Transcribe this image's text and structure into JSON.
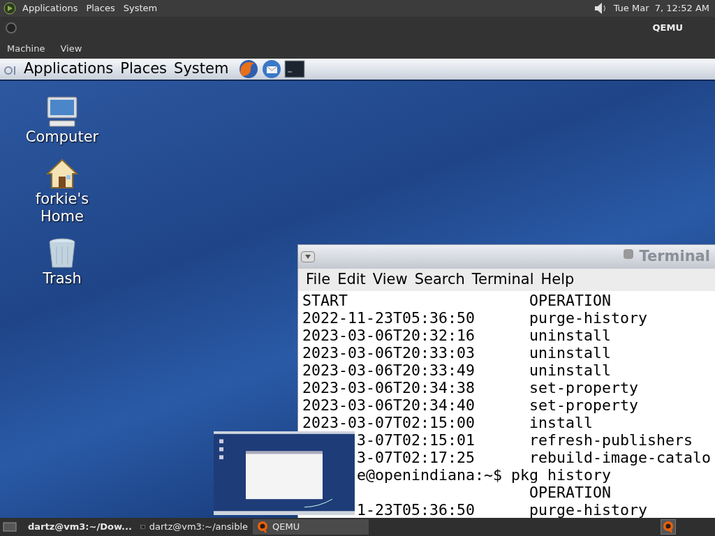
{
  "host_panel": {
    "menus": [
      "Applications",
      "Places",
      "System"
    ],
    "clock": "Tue Mar  7, 12:52 AM"
  },
  "qemu_window": {
    "title": "QEMU",
    "menus": [
      "Machine",
      "View"
    ]
  },
  "guest_panel": {
    "menus": [
      "Applications",
      "Places",
      "System"
    ]
  },
  "desktop_icons": [
    {
      "kind": "computer",
      "label": "Computer"
    },
    {
      "kind": "home",
      "label": "forkie's Home"
    },
    {
      "kind": "trash",
      "label": "Trash"
    }
  ],
  "terminal": {
    "title": "Terminal",
    "menus": [
      "File",
      "Edit",
      "View",
      "Search",
      "Terminal",
      "Help"
    ],
    "lines": [
      {
        "kind": "row",
        "start": "START",
        "operation": "OPERATION"
      },
      {
        "kind": "row",
        "start": "2022-11-23T05:36:50",
        "operation": "purge-history"
      },
      {
        "kind": "row",
        "start": "2023-03-06T20:32:16",
        "operation": "uninstall"
      },
      {
        "kind": "row",
        "start": "2023-03-06T20:33:03",
        "operation": "uninstall"
      },
      {
        "kind": "row",
        "start": "2023-03-06T20:33:49",
        "operation": "uninstall"
      },
      {
        "kind": "row",
        "start": "2023-03-06T20:34:38",
        "operation": "set-property"
      },
      {
        "kind": "row",
        "start": "2023-03-06T20:34:40",
        "operation": "set-property"
      },
      {
        "kind": "row",
        "start": "2023-03-07T02:15:00",
        "operation": "install"
      },
      {
        "kind": "cut",
        "start": "3-07T02:15:01",
        "operation": "refresh-publishers"
      },
      {
        "kind": "cut",
        "start": "3-07T02:17:25",
        "operation": "rebuild-image-catalo"
      },
      {
        "kind": "prompt",
        "text": "e@openindiana:~$ pkg history"
      },
      {
        "kind": "row",
        "operation": "OPERATION"
      },
      {
        "kind": "cut",
        "start": "1-23T05:36:50",
        "operation": "purge-history"
      }
    ]
  },
  "taskbar": [
    {
      "label": "dartz@vm3:~/Dow...",
      "selected": false,
      "urgent": true,
      "kind": "terminal"
    },
    {
      "label": "dartz@vm3:~/ansible",
      "selected": false,
      "urgent": false,
      "kind": "terminal"
    },
    {
      "label": "QEMU",
      "selected": true,
      "urgent": false,
      "kind": "qemu"
    }
  ]
}
